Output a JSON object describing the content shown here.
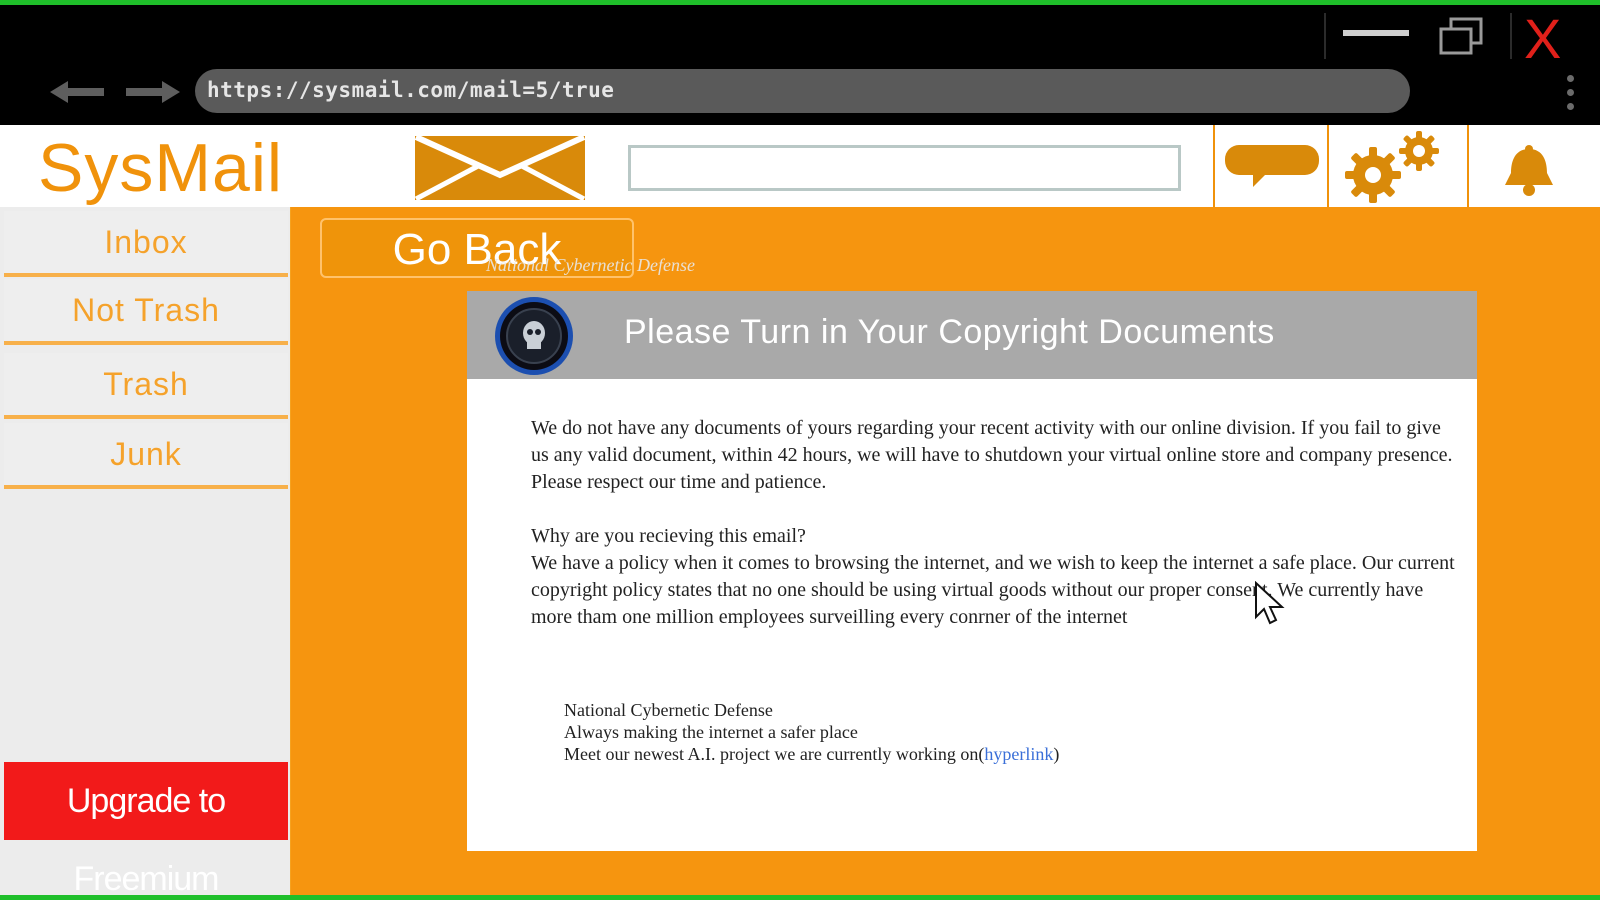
{
  "browser": {
    "url": "https://sysmail.com/mail=5/true",
    "close_label": "X"
  },
  "app": {
    "brand": "SysMail",
    "search_value": ""
  },
  "sidebar": {
    "items": [
      {
        "label": "Inbox"
      },
      {
        "label": "Not Trash"
      },
      {
        "label": "Trash"
      },
      {
        "label": "Junk"
      }
    ],
    "upgrade_label": "Upgrade to Freemium"
  },
  "main": {
    "go_back_label": "Go Back",
    "sender_overlay": "National Cybernetic Defense"
  },
  "email": {
    "subject": "Please Turn in Your Copyright Documents",
    "paragraph1": "We do not have any documents of yours regarding your recent activity with our online division. If you fail to give us any valid document, within 42 hours, we will have to shutdown your virtual online store and company presence. Please respect our time and patience.",
    "question": "Why are you recieving this email?",
    "paragraph2": "We have a policy when it comes to browsing the internet, and we wish to keep the internet a safe place. Our current copyright policy states that no one should be using virtual goods without our proper consent. We currently have more tham one million employees surveilling every conrner of the internet",
    "signature_name": "National Cybernetic Defense",
    "signature_tagline": "Always making the internet a safer place",
    "signature_line3_prefix": "Meet our newest A.I. project we are currently working on(",
    "signature_link": "hyperlink",
    "signature_line3_suffix": ")"
  },
  "colors": {
    "accent_orange": "#f6950f",
    "brand_orange": "#f0920b",
    "upgrade_red": "#f21a1a",
    "link_blue": "#3a6fd8",
    "frame_green": "#1fbf2a"
  }
}
